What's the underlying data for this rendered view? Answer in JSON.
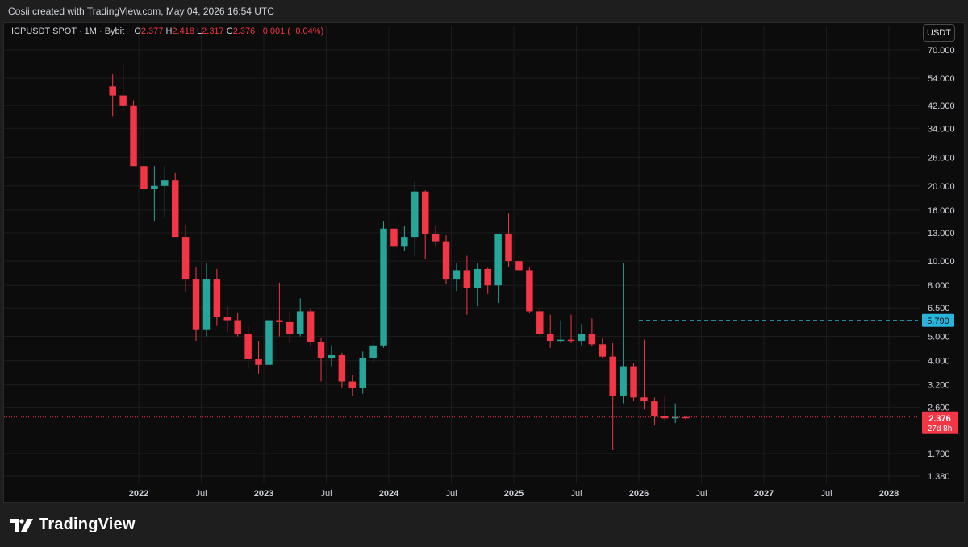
{
  "header": {
    "attribution": "Cosii created with TradingView.com, May 04, 2026 16:54 UTC"
  },
  "legend": {
    "symbol": "ICPUSDT SPOT · 1M · Bybit",
    "o_label": "O",
    "o_value": "2.377",
    "h_label": "H",
    "h_value": "2.418",
    "l_label": "L",
    "l_value": "2.317",
    "c_label": "C",
    "c_value": "2.376",
    "change": "−0.001 (−0.04%)"
  },
  "toolbar": {
    "currency_label": "USDT"
  },
  "footer": {
    "brand": "TradingView"
  },
  "colors": {
    "up": "#26a69a",
    "down": "#f23645",
    "level": "#2ab4dc",
    "grid": "#1c1c1c"
  },
  "chart_data": {
    "type": "candlestick",
    "interval": "1M",
    "y_scale": "log",
    "ylim": [
      1.3,
      75
    ],
    "y_ticks": [
      "70.000",
      "54.000",
      "42.000",
      "34.000",
      "26.000",
      "20.000",
      "16.000",
      "13.000",
      "10.000",
      "8.000",
      "6.500",
      "5.000",
      "4.000",
      "3.200",
      "2.600",
      "1.700",
      "1.380"
    ],
    "x_ticks": [
      "2022",
      "Jul",
      "2023",
      "Jul",
      "2024",
      "Jul",
      "2025",
      "Jul",
      "2026",
      "Jul",
      "2027",
      "Jul",
      "2028"
    ],
    "candles": [
      {
        "date": "2021-10",
        "o": 50.0,
        "h": 56.0,
        "l": 38.0,
        "c": 46.0
      },
      {
        "date": "2021-11",
        "o": 46.0,
        "h": 61.0,
        "l": 40.0,
        "c": 42.0
      },
      {
        "date": "2021-12",
        "o": 42.0,
        "h": 44.0,
        "l": 24.0,
        "c": 24.0
      },
      {
        "date": "2022-01",
        "o": 24.0,
        "h": 38.0,
        "l": 18.0,
        "c": 19.5
      },
      {
        "date": "2022-02",
        "o": 19.5,
        "h": 24.0,
        "l": 14.5,
        "c": 20.0
      },
      {
        "date": "2022-03",
        "o": 20.0,
        "h": 24.0,
        "l": 15.0,
        "c": 21.0
      },
      {
        "date": "2022-04",
        "o": 21.0,
        "h": 22.5,
        "l": 15.5,
        "c": 12.5
      },
      {
        "date": "2022-05",
        "o": 12.5,
        "h": 14.0,
        "l": 7.5,
        "c": 8.5
      },
      {
        "date": "2022-06",
        "o": 8.5,
        "h": 9.5,
        "l": 4.8,
        "c": 5.3
      },
      {
        "date": "2022-07",
        "o": 5.3,
        "h": 9.8,
        "l": 5.0,
        "c": 8.5
      },
      {
        "date": "2022-08",
        "o": 8.5,
        "h": 9.3,
        "l": 5.5,
        "c": 6.0
      },
      {
        "date": "2022-09",
        "o": 6.0,
        "h": 6.6,
        "l": 5.2,
        "c": 5.8
      },
      {
        "date": "2022-10",
        "o": 5.8,
        "h": 6.2,
        "l": 5.0,
        "c": 5.1
      },
      {
        "date": "2022-11",
        "o": 5.1,
        "h": 5.5,
        "l": 3.7,
        "c": 4.05
      },
      {
        "date": "2022-12",
        "o": 4.05,
        "h": 4.8,
        "l": 3.55,
        "c": 3.85
      },
      {
        "date": "2023-01",
        "o": 3.85,
        "h": 6.4,
        "l": 3.7,
        "c": 5.8
      },
      {
        "date": "2023-02",
        "o": 5.8,
        "h": 8.2,
        "l": 5.0,
        "c": 5.7
      },
      {
        "date": "2023-03",
        "o": 5.7,
        "h": 6.3,
        "l": 4.7,
        "c": 5.1
      },
      {
        "date": "2023-04",
        "o": 5.1,
        "h": 7.1,
        "l": 5.0,
        "c": 6.3
      },
      {
        "date": "2023-05",
        "o": 6.3,
        "h": 6.5,
        "l": 4.6,
        "c": 4.75
      },
      {
        "date": "2023-06",
        "o": 4.75,
        "h": 4.95,
        "l": 3.3,
        "c": 4.1
      },
      {
        "date": "2023-07",
        "o": 4.1,
        "h": 4.6,
        "l": 3.8,
        "c": 4.2
      },
      {
        "date": "2023-08",
        "o": 4.2,
        "h": 4.3,
        "l": 3.1,
        "c": 3.3
      },
      {
        "date": "2023-09",
        "o": 3.3,
        "h": 3.5,
        "l": 2.9,
        "c": 3.1
      },
      {
        "date": "2023-10",
        "o": 3.1,
        "h": 4.35,
        "l": 2.95,
        "c": 4.1
      },
      {
        "date": "2023-11",
        "o": 4.1,
        "h": 4.8,
        "l": 3.9,
        "c": 4.6
      },
      {
        "date": "2023-12",
        "o": 4.6,
        "h": 14.5,
        "l": 4.5,
        "c": 13.5
      },
      {
        "date": "2024-01",
        "o": 13.5,
        "h": 15.5,
        "l": 10.0,
        "c": 11.5
      },
      {
        "date": "2024-02",
        "o": 11.5,
        "h": 13.8,
        "l": 11.0,
        "c": 12.5
      },
      {
        "date": "2024-03",
        "o": 12.5,
        "h": 20.8,
        "l": 10.5,
        "c": 19.0
      },
      {
        "date": "2024-04",
        "o": 19.0,
        "h": 19.2,
        "l": 10.2,
        "c": 12.8
      },
      {
        "date": "2024-05",
        "o": 12.8,
        "h": 13.9,
        "l": 11.5,
        "c": 12.0
      },
      {
        "date": "2024-06",
        "o": 12.0,
        "h": 12.7,
        "l": 8.1,
        "c": 8.5
      },
      {
        "date": "2024-07",
        "o": 8.5,
        "h": 9.8,
        "l": 7.6,
        "c": 9.2
      },
      {
        "date": "2024-08",
        "o": 9.2,
        "h": 10.5,
        "l": 6.1,
        "c": 7.8
      },
      {
        "date": "2024-09",
        "o": 7.8,
        "h": 9.8,
        "l": 6.6,
        "c": 9.3
      },
      {
        "date": "2024-10",
        "o": 9.3,
        "h": 9.4,
        "l": 7.4,
        "c": 8.0
      },
      {
        "date": "2024-11",
        "o": 8.0,
        "h": 12.8,
        "l": 6.8,
        "c": 12.8
      },
      {
        "date": "2024-12",
        "o": 12.8,
        "h": 15.5,
        "l": 9.5,
        "c": 10.0
      },
      {
        "date": "2025-01",
        "o": 10.0,
        "h": 10.5,
        "l": 8.9,
        "c": 9.2
      },
      {
        "date": "2025-02",
        "o": 9.2,
        "h": 9.5,
        "l": 6.2,
        "c": 6.3
      },
      {
        "date": "2025-03",
        "o": 6.3,
        "h": 6.5,
        "l": 5.0,
        "c": 5.1
      },
      {
        "date": "2025-04",
        "o": 5.1,
        "h": 6.1,
        "l": 4.5,
        "c": 4.8
      },
      {
        "date": "2025-05",
        "o": 4.8,
        "h": 5.8,
        "l": 4.7,
        "c": 4.85
      },
      {
        "date": "2025-06",
        "o": 4.85,
        "h": 6.1,
        "l": 4.7,
        "c": 4.8
      },
      {
        "date": "2025-07",
        "o": 4.8,
        "h": 5.6,
        "l": 4.6,
        "c": 5.1
      },
      {
        "date": "2025-08",
        "o": 5.1,
        "h": 5.9,
        "l": 4.55,
        "c": 4.65
      },
      {
        "date": "2025-09",
        "o": 4.65,
        "h": 4.9,
        "l": 4.1,
        "c": 4.15
      },
      {
        "date": "2025-10",
        "o": 4.15,
        "h": 4.7,
        "l": 1.75,
        "c": 2.9
      },
      {
        "date": "2025-11",
        "o": 2.9,
        "h": 9.8,
        "l": 2.7,
        "c": 3.8
      },
      {
        "date": "2025-12",
        "o": 3.8,
        "h": 3.9,
        "l": 2.75,
        "c": 2.85
      },
      {
        "date": "2026-01",
        "o": 2.85,
        "h": 4.85,
        "l": 2.55,
        "c": 2.75
      },
      {
        "date": "2026-02",
        "o": 2.75,
        "h": 2.85,
        "l": 2.2,
        "c": 2.4
      },
      {
        "date": "2026-03",
        "o": 2.4,
        "h": 2.9,
        "l": 2.3,
        "c": 2.35
      },
      {
        "date": "2026-04",
        "o": 2.35,
        "h": 2.7,
        "l": 2.25,
        "c": 2.377
      },
      {
        "date": "2026-05",
        "o": 2.377,
        "h": 2.418,
        "l": 2.317,
        "c": 2.376
      }
    ],
    "level_line": {
      "value": 5.79,
      "label": "5.790"
    },
    "last_price": {
      "value": 2.376,
      "label": "2.376",
      "countdown": "27d 8h"
    }
  }
}
